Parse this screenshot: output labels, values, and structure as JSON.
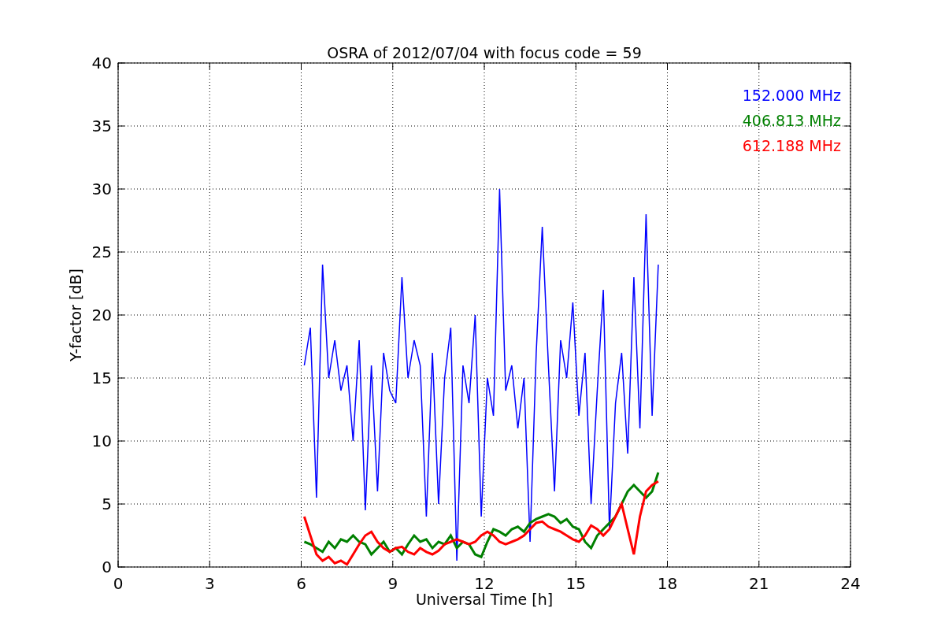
{
  "chart_data": {
    "type": "line",
    "title": "OSRA of 2012/07/04 with focus code = 59",
    "xlabel": "Universal Time [h]",
    "ylabel": "Y-factor [dB]",
    "grid": true,
    "xlim": [
      0,
      24
    ],
    "ylim": [
      0,
      40
    ],
    "xticks": [
      0,
      3,
      6,
      9,
      12,
      15,
      18,
      21,
      24
    ],
    "yticks": [
      0,
      5,
      10,
      15,
      20,
      25,
      30,
      35,
      40
    ],
    "x": [
      6.1,
      6.3,
      6.5,
      6.7,
      6.9,
      7.1,
      7.3,
      7.5,
      7.7,
      7.9,
      8.1,
      8.3,
      8.5,
      8.7,
      8.9,
      9.1,
      9.3,
      9.5,
      9.7,
      9.9,
      10.1,
      10.3,
      10.5,
      10.7,
      10.9,
      11.1,
      11.3,
      11.5,
      11.7,
      11.9,
      12.1,
      12.3,
      12.5,
      12.7,
      12.9,
      13.1,
      13.3,
      13.5,
      13.7,
      13.9,
      14.1,
      14.3,
      14.5,
      14.7,
      14.9,
      15.1,
      15.3,
      15.5,
      15.7,
      15.9,
      16.1,
      16.3,
      16.5,
      16.7,
      16.9,
      17.1,
      17.3,
      17.5,
      17.7
    ],
    "series": [
      {
        "name": "152.000 MHz",
        "color": "#0000ff",
        "values": [
          16,
          19,
          5.5,
          24,
          15,
          18,
          14,
          16,
          10,
          18,
          4.5,
          16,
          6,
          17,
          14,
          13,
          23,
          15,
          18,
          16,
          4,
          17,
          5,
          15,
          19,
          0.5,
          16,
          13,
          20,
          4,
          15,
          12,
          30,
          14,
          16,
          11,
          15,
          2,
          17,
          27,
          16,
          6,
          18,
          15,
          21,
          12,
          17,
          5,
          14,
          22,
          3,
          13,
          17,
          9,
          23,
          11,
          28,
          12,
          24
        ]
      },
      {
        "name": "406.813 MHz",
        "color": "#008000",
        "values": [
          2,
          1.8,
          1.5,
          1.2,
          2,
          1.5,
          2.2,
          2,
          2.5,
          2,
          1.8,
          1,
          1.5,
          2,
          1.2,
          1.5,
          1,
          1.8,
          2.5,
          2,
          2.2,
          1.5,
          2,
          1.8,
          2.5,
          1.5,
          2,
          1.8,
          1,
          0.8,
          2,
          3,
          2.8,
          2.5,
          3,
          3.2,
          2.8,
          3.5,
          3.8,
          4,
          4.2,
          4,
          3.5,
          3.8,
          3.2,
          3,
          2,
          1.5,
          2.5,
          3,
          3.5,
          4,
          5,
          6,
          6.5,
          6,
          5.5,
          6,
          7.5
        ]
      },
      {
        "name": "612.188 MHz",
        "color": "#ff0000",
        "values": [
          4,
          2.5,
          1,
          0.5,
          0.8,
          0.3,
          0.5,
          0.2,
          1,
          1.8,
          2.5,
          2.8,
          2,
          1.5,
          1.2,
          1.5,
          1.6,
          1.2,
          1,
          1.5,
          1.2,
          1,
          1.3,
          1.8,
          2,
          2.2,
          2,
          1.8,
          2,
          2.5,
          2.8,
          2.5,
          2,
          1.8,
          2,
          2.2,
          2.5,
          3,
          3.5,
          3.6,
          3.2,
          3,
          2.8,
          2.5,
          2.2,
          2,
          2.5,
          3.3,
          3,
          2.5,
          3,
          4,
          5,
          3,
          1,
          4,
          6,
          6.5,
          6.8
        ]
      }
    ]
  }
}
